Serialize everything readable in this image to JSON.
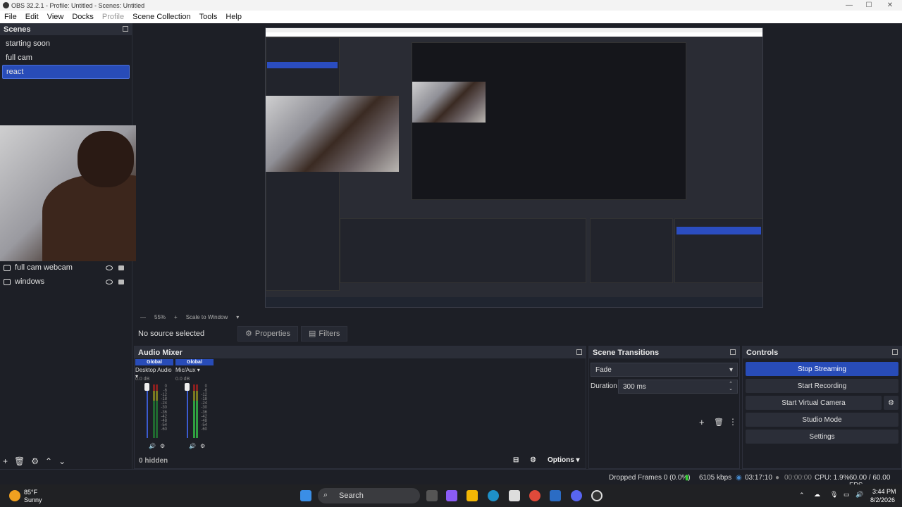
{
  "window": {
    "title": "OBS 32.2.1 - Profile: Untitled - Scenes: Untitled",
    "min": "—",
    "max": "☐",
    "close": "✕"
  },
  "menu": {
    "file": "File",
    "edit": "Edit",
    "view": "View",
    "docks": "Docks",
    "profile": "Profile",
    "scene_collection": "Scene Collection",
    "tools": "Tools",
    "help": "Help"
  },
  "scenes": {
    "title": "Scenes",
    "items": [
      {
        "label": "starting soon"
      },
      {
        "label": "full cam"
      },
      {
        "label": "react"
      }
    ],
    "active_index": 2,
    "toolbar": {
      "add": "+",
      "remove": "🗑",
      "settings": "⚙",
      "up": "⌃",
      "down": "⌄"
    }
  },
  "sources": {
    "items": [
      {
        "label": "full cam webcam",
        "icon": "camera-icon"
      },
      {
        "label": "windows",
        "icon": "monitor-icon"
      }
    ]
  },
  "preview": {
    "zoom_minus": "—",
    "zoom": "55%",
    "zoom_plus": "+",
    "scale_mode": "Scale to Window"
  },
  "source_bar": {
    "no_source": "No source selected",
    "properties": "Properties",
    "filters": "Filters"
  },
  "audio_mixer": {
    "title": "Audio Mixer",
    "channels": [
      {
        "global": "Global",
        "name": "Desktop Audio",
        "db": "0.0 dB"
      },
      {
        "global": "Global",
        "name": "Mic/Aux",
        "db": "0.0 dB"
      }
    ],
    "scale": [
      "0",
      "-6",
      "-12",
      "-18",
      "-24",
      "-30",
      "-36",
      "-42",
      "-48",
      "-54",
      "-60"
    ],
    "footer_hidden": "0 hidden",
    "options": "Options"
  },
  "transitions": {
    "title": "Scene Transitions",
    "selected": "Fade",
    "duration_label": "Duration",
    "duration_value": "300 ms"
  },
  "controls": {
    "title": "Controls",
    "stop_streaming": "Stop Streaming",
    "start_recording": "Start Recording",
    "start_virtual_camera": "Start Virtual Camera",
    "studio_mode": "Studio Mode",
    "settings": "Settings"
  },
  "status": {
    "dropped": "Dropped Frames 0 (0.0%)",
    "kbps": "6105 kbps",
    "stream_time": "03:17:10",
    "rec_time": "00:00:00",
    "cpu": "CPU: 1.9%",
    "fps": "60.00 / 60.00 FPS"
  },
  "taskbar": {
    "weather_temp": "85°F",
    "weather_desc": "Sunny",
    "search": "Search",
    "time": "3:44 PM",
    "date": "8/2/2026"
  },
  "colors": {
    "accent": "#284cb8",
    "bg": "#1d1f26",
    "dock_title": "#2b2e38"
  }
}
